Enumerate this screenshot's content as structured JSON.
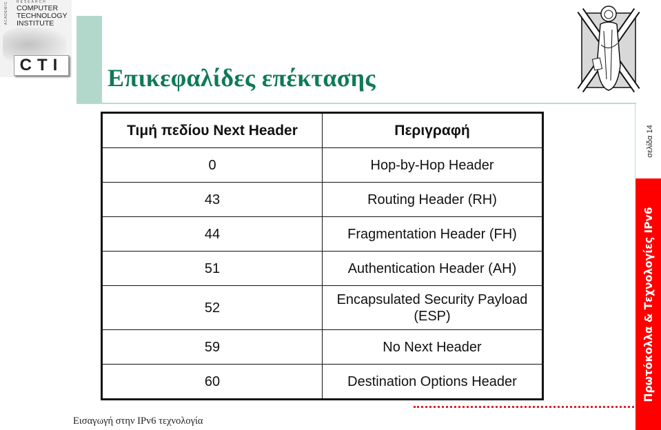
{
  "logo": {
    "top_small": "RESEARCH",
    "side_small": "ACADEMIC",
    "lines": [
      "COMPUTER",
      "TECHNOLOGY",
      "INSTITUTE"
    ],
    "mark": "CTI"
  },
  "slide": {
    "title": "Επικεφαλίδες επέκτασης",
    "page_label": "σελίδα 14",
    "side_band": "Πρωτόκολλα & Τεχνολογίες IPv6",
    "footer": "Εισαγωγή στην IPv6 τεχνολογία"
  },
  "table": {
    "headers": [
      "Τιμή πεδίου Next Header",
      "Περιγραφή"
    ],
    "rows": [
      {
        "value": "0",
        "description": "Hop-by-Hop Header"
      },
      {
        "value": "43",
        "description": "Routing Header (RH)"
      },
      {
        "value": "44",
        "description": "Fragmentation Header (FH)"
      },
      {
        "value": "51",
        "description": "Authentication Header (AH)"
      },
      {
        "value": "52",
        "description": "Encapsulated Security Payload",
        "description2": "(ESP)"
      },
      {
        "value": "59",
        "description": "No Next Header"
      },
      {
        "value": "60",
        "description": "Destination Options Header"
      }
    ]
  },
  "colors": {
    "title": "#0f7a57",
    "accent": "#b2d8cc",
    "band": "#ff0000"
  }
}
